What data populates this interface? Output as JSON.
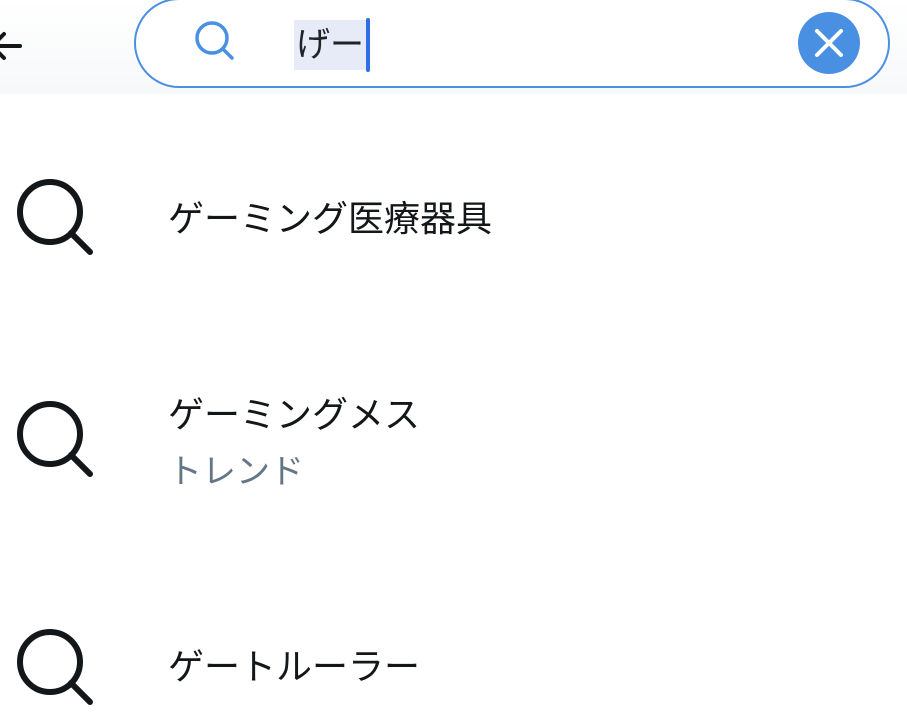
{
  "search": {
    "query": "げー"
  },
  "suggestions": [
    {
      "title": "ゲーミング医療器具",
      "subtitle": ""
    },
    {
      "title": "ゲーミングメス",
      "subtitle": "トレンド"
    },
    {
      "title": "ゲートルーラー",
      "subtitle": ""
    }
  ],
  "colors": {
    "accent": "#4a90e2",
    "caret": "#2f6fe6",
    "selection": "#e6ebf7",
    "primary_text": "#14171a",
    "secondary_text": "#657786"
  },
  "icons": {
    "back": "back-arrow-icon",
    "search": "search-icon",
    "clear": "clear-icon"
  }
}
